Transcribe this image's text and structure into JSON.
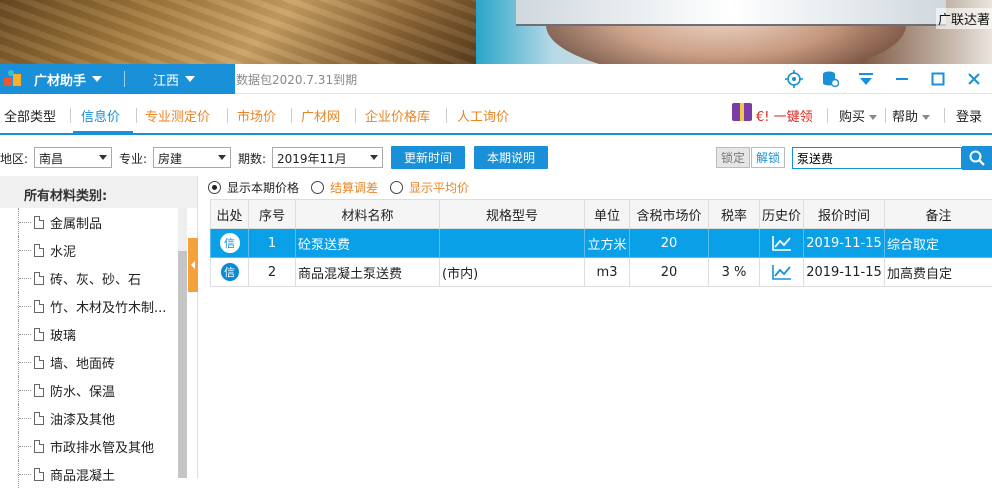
{
  "banner": {
    "tag_text": "广联达著"
  },
  "titlebar": {
    "app_name": "广材助手",
    "region": "江西",
    "datapack": "数据包2020.7.31到期"
  },
  "tabs": {
    "all": "全部类型",
    "items": [
      "信息价",
      "专业测定价",
      "市场价",
      "广材网",
      "企业价格库",
      "人工询价"
    ],
    "active_index": 0
  },
  "right_menu": {
    "promo": "€! 一键领",
    "buy": "购买",
    "help": "帮助",
    "login": "登录"
  },
  "filter": {
    "area_label": "地区:",
    "area_value": "南昌",
    "major_label": "专业:",
    "major_value": "房建",
    "period_label": "期数:",
    "period_value": "2019年11月",
    "update_btn": "更新时间",
    "desc_btn": "本期说明",
    "lock_btn": "锁定",
    "unlock_btn": "解锁",
    "search_value": "泵送费"
  },
  "sidebar": {
    "title": "所有材料类别:",
    "items": [
      "金属制品",
      "水泥",
      "砖、灰、砂、石",
      "竹、木材及竹木制...",
      "玻璃",
      "墙、地面砖",
      "防水、保温",
      "油漆及其他",
      "市政排水管及其他",
      "商品混凝土"
    ]
  },
  "options": {
    "show_current": "显示本期价格",
    "settle_adjust": "结算调差",
    "show_avg": "显示平均价"
  },
  "table": {
    "headers": [
      "出处",
      "序号",
      "材料名称",
      "规格型号",
      "单位",
      "含税市场价",
      "税率",
      "历史价",
      "报价时间",
      "备注"
    ],
    "rows": [
      {
        "source": "信",
        "no": "1",
        "name": "砼泵送费",
        "spec": "",
        "unit": "立方米",
        "price": "20",
        "tax": "",
        "date": "2019-11-15",
        "note": "综合取定"
      },
      {
        "source": "信",
        "no": "2",
        "name": "商品混凝土泵送费",
        "spec": "(市内)",
        "unit": "m3",
        "price": "20",
        "tax": "3 %",
        "date": "2019-11-15",
        "note": "加高费自定"
      }
    ]
  },
  "colors": {
    "primary": "#1a90d8",
    "accent_orange": "#e8862a",
    "selected_row": "#0aa0e8"
  }
}
